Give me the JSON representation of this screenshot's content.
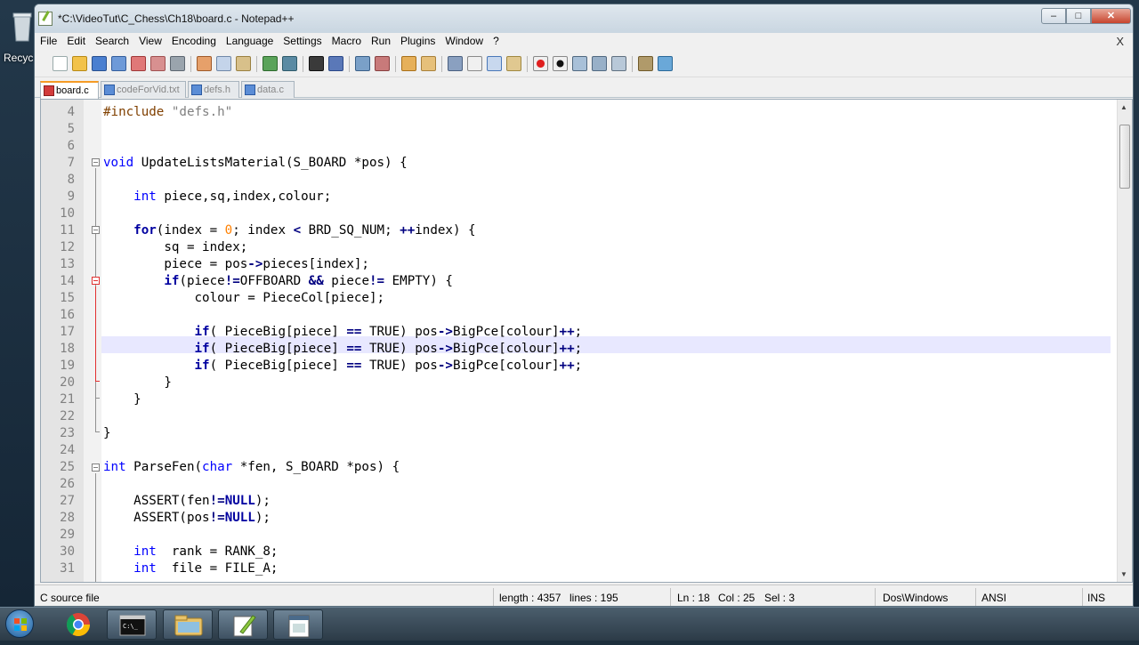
{
  "desktop": {
    "recycle_label": "Recyc"
  },
  "window": {
    "title": "*C:\\VideoTut\\C_Chess\\Ch18\\board.c - Notepad++",
    "buttons": {
      "minimize": "–",
      "maximize": "□",
      "close": "✕"
    }
  },
  "menu": {
    "items": [
      "File",
      "Edit",
      "Search",
      "View",
      "Encoding",
      "Language",
      "Settings",
      "Macro",
      "Run",
      "Plugins",
      "Window",
      "?"
    ],
    "close": "X"
  },
  "tabs": [
    {
      "label": "board.c",
      "active": true
    },
    {
      "label": "codeForVid.txt",
      "active": false
    },
    {
      "label": "defs.h",
      "active": false
    },
    {
      "label": "data.c",
      "active": false
    }
  ],
  "editor": {
    "current_line": 18,
    "lines": [
      {
        "n": "4",
        "text": "#include \"defs.h\""
      },
      {
        "n": "5",
        "text": ""
      },
      {
        "n": "6",
        "text": ""
      },
      {
        "n": "7",
        "text": "void UpdateListsMaterial(S_BOARD *pos) {"
      },
      {
        "n": "8",
        "text": ""
      },
      {
        "n": "9",
        "text": "    int piece,sq,index,colour;"
      },
      {
        "n": "10",
        "text": ""
      },
      {
        "n": "11",
        "text": "    for(index = 0; index < BRD_SQ_NUM; ++index) {"
      },
      {
        "n": "12",
        "text": "        sq = index;"
      },
      {
        "n": "13",
        "text": "        piece = pos->pieces[index];"
      },
      {
        "n": "14",
        "text": "        if(piece!=OFFBOARD && piece!= EMPTY) {"
      },
      {
        "n": "15",
        "text": "            colour = PieceCol[piece];"
      },
      {
        "n": "16",
        "text": ""
      },
      {
        "n": "17",
        "text": "            if( PieceBig[piece] == TRUE) pos->BigPce[colour]++;"
      },
      {
        "n": "18",
        "text": "            if( PieceBig[piece] == TRUE) pos->BigPce[colour]++;"
      },
      {
        "n": "19",
        "text": "            if( PieceBig[piece] == TRUE) pos->BigPce[colour]++;"
      },
      {
        "n": "20",
        "text": "        }"
      },
      {
        "n": "21",
        "text": "    }"
      },
      {
        "n": "22",
        "text": ""
      },
      {
        "n": "23",
        "text": "}"
      },
      {
        "n": "24",
        "text": ""
      },
      {
        "n": "25",
        "text": "int ParseFen(char *fen, S_BOARD *pos) {"
      },
      {
        "n": "26",
        "text": ""
      },
      {
        "n": "27",
        "text": "    ASSERT(fen!=NULL);"
      },
      {
        "n": "28",
        "text": "    ASSERT(pos!=NULL);"
      },
      {
        "n": "29",
        "text": ""
      },
      {
        "n": "30",
        "text": "    int  rank = RANK_8;"
      },
      {
        "n": "31",
        "text": "    int  file = FILE_A;"
      }
    ]
  },
  "status": {
    "filetype": "C source file",
    "length": "length : 4357",
    "lines": "lines : 195",
    "ln": "Ln : 18",
    "col": "Col : 25",
    "sel": "Sel : 3",
    "eol": "Dos\\Windows",
    "encoding": "ANSI",
    "mode": "INS"
  },
  "taskbar": {
    "items": [
      "start-button",
      "chrome-icon",
      "cmd-icon",
      "explorer-icon",
      "notepadpp-icon",
      "app-window-icon"
    ]
  },
  "colors": {
    "keyword": "#0000ff",
    "type": "#0000a0",
    "number": "#ff8000",
    "string": "#808080",
    "preprocessor": "#804000",
    "current_line": "#e8e8ff",
    "tab_accent": "#f59b26"
  }
}
